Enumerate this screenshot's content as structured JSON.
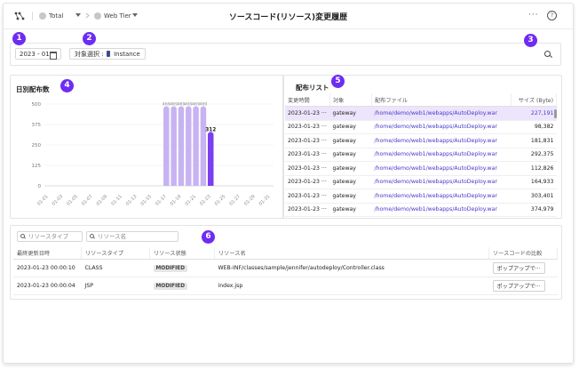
{
  "header": {
    "app_icon": "network-icon",
    "workspace": "Total",
    "tier": "Web Tier",
    "title": "ソースコード(リソース)変更履歴",
    "more_label": "···",
    "help_label": "?"
  },
  "badges": [
    "1",
    "2",
    "3",
    "4",
    "5",
    "6"
  ],
  "filter": {
    "date_value": "2023 - 01",
    "target_label": "対象選択 :",
    "target_value": "Instance"
  },
  "chart_panel": {
    "title": "日別配布数"
  },
  "chart_data": {
    "type": "bar",
    "title": "日別配布数",
    "categories": [
      "01-01",
      "01-03",
      "01-05",
      "01-07",
      "01-09",
      "01-11",
      "01-13",
      "01-15",
      "01-17",
      "01-19",
      "01-21",
      "01-23",
      "01-25",
      "01-27",
      "01-29",
      "01-31"
    ],
    "x_dates": [
      "01-17",
      "01-18",
      "01-19",
      "01-20",
      "01-21",
      "01-22",
      "01-23"
    ],
    "values": [
      469,
      469,
      469,
      469,
      469,
      469,
      312
    ],
    "data_labels": [
      "469",
      "469",
      "469",
      "469",
      "469",
      "469",
      "312"
    ],
    "yticks": [
      0,
      125,
      250,
      375,
      500
    ],
    "ylim": [
      0,
      500
    ],
    "colors": {
      "normal": "#c7b3f2",
      "selected": "#7a3ff0"
    },
    "grid": true
  },
  "deploy_panel": {
    "title": "配布リスト",
    "columns": [
      "変更時間",
      "対象",
      "配布ファイル",
      "サイズ (Byte)"
    ],
    "rows": [
      {
        "time": "2023-01-23 ···",
        "target": "gateway",
        "file": "/home/demo/web1/webapps/AutoDeploy.war",
        "size": "227,191",
        "selected": true
      },
      {
        "time": "2023-01-23 ···",
        "target": "gateway",
        "file": "/home/demo/web1/webapps/AutoDeploy.war",
        "size": "98,382"
      },
      {
        "time": "2023-01-23 ···",
        "target": "gateway",
        "file": "/home/demo/web1/webapps/AutoDeploy.war",
        "size": "181,831"
      },
      {
        "time": "2023-01-23 ···",
        "target": "gateway",
        "file": "/home/demo/web1/webapps/AutoDeploy.war",
        "size": "292,375"
      },
      {
        "time": "2023-01-23 ···",
        "target": "gateway",
        "file": "/home/demo/web1/webapps/AutoDeploy.war",
        "size": "112,826"
      },
      {
        "time": "2023-01-23 ···",
        "target": "gateway",
        "file": "/home/demo/web1/webapps/AutoDeploy.war",
        "size": "164,933"
      },
      {
        "time": "2023-01-23 ···",
        "target": "gateway",
        "file": "/home/demo/web1/webapps/AutoDeploy.war",
        "size": "303,401"
      },
      {
        "time": "2023-01-23 ···",
        "target": "gateway",
        "file": "/home/demo/web1/webapps/AutoDeploy.war",
        "size": "374,979"
      }
    ]
  },
  "resource_panel": {
    "type_search_placeholder": "リソースタイプ",
    "name_search_placeholder": "リソース名",
    "columns": [
      "最終更新日時",
      "リソースタイプ",
      "リソース状態",
      "リソース名",
      "ソースコードの比較"
    ],
    "rows": [
      {
        "updated": "2023-01-23 00:00:10",
        "type": "CLASS",
        "status": "MODIFIED",
        "name": "WEB-INF/classes/sample/jennifer/autodeploy/Controller.class",
        "action": "ポップアップで···"
      },
      {
        "updated": "2023-01-23 00:00:04",
        "type": "JSP",
        "status": "MODIFIED",
        "name": "index.jsp",
        "action": "ポップアップで···"
      }
    ]
  }
}
